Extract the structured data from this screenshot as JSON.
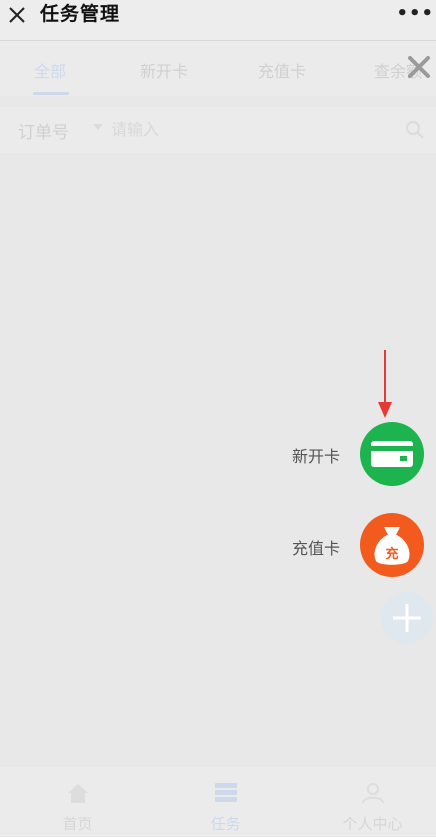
{
  "window": {
    "title": "任务管理",
    "more": "•••"
  },
  "tabs": [
    "全部",
    "新开卡",
    "充值卡",
    "查余额"
  ],
  "search": {
    "field": "订单号",
    "placeholder": "请输入"
  },
  "tabbar": [
    {
      "label": "首页",
      "icon": "home-icon"
    },
    {
      "label": "任务",
      "icon": "task-icon"
    },
    {
      "label": "个人中心",
      "icon": "user-icon"
    }
  ],
  "fab_menu": [
    {
      "label": "新开卡",
      "icon": "card-icon",
      "color": "#1db34e"
    },
    {
      "label": "充值卡",
      "icon": "money-bag-icon",
      "badge": "充",
      "color": "#f25a1e"
    }
  ],
  "colors": {
    "accent": "#1e7cff",
    "annotation_arrow": "#e53935"
  }
}
